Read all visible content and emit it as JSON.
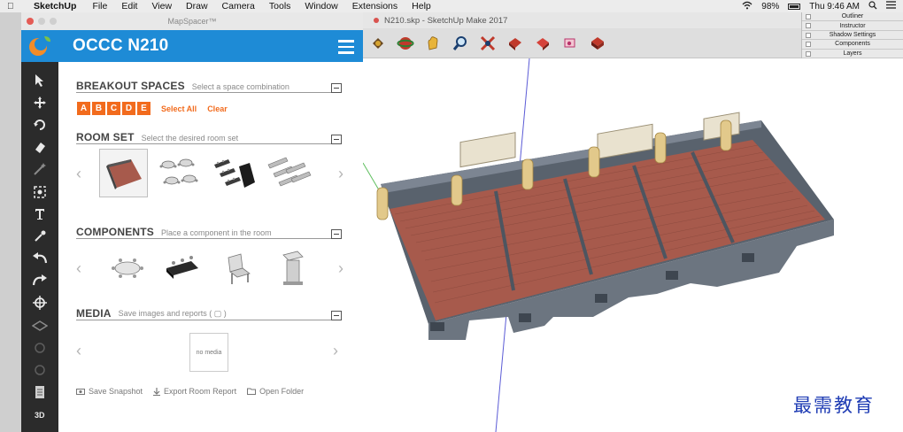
{
  "menubar": {
    "app": "SketchUp",
    "items": [
      "File",
      "Edit",
      "View",
      "Draw",
      "Camera",
      "Tools",
      "Window",
      "Extensions",
      "Help"
    ],
    "battery": "98%",
    "clock": "Thu 9:46 AM"
  },
  "sketchup": {
    "title": "N210.skp - SketchUp Make 2017"
  },
  "tray": {
    "items": [
      "Outliner",
      "Instructor",
      "Shadow Settings",
      "Components",
      "Layers"
    ]
  },
  "mapspacer": {
    "window_title": "MapSpacer™",
    "header_title": "OCCC N210",
    "breakout": {
      "title": "BREAKOUT SPACES",
      "hint": "Select a space combination",
      "letters": [
        "A",
        "B",
        "C",
        "D",
        "E"
      ],
      "select_all": "Select All",
      "clear": "Clear"
    },
    "room_set": {
      "title": "ROOM SET",
      "hint": "Select the desired room set"
    },
    "components": {
      "title": "COMPONENTS",
      "hint": "Place a component in the room"
    },
    "media": {
      "title": "MEDIA",
      "hint": "Save images and reports ( ▢ )",
      "no_media": "no media"
    },
    "actions": {
      "snapshot": "Save Snapshot",
      "export": "Export Room Report",
      "open": "Open Folder"
    }
  },
  "watermark": "最需教育",
  "colors": {
    "brand_blue": "#1e8bd6",
    "accent_orange": "#f26b1d",
    "floor": "#a75a4c",
    "wall": "#56606c"
  }
}
